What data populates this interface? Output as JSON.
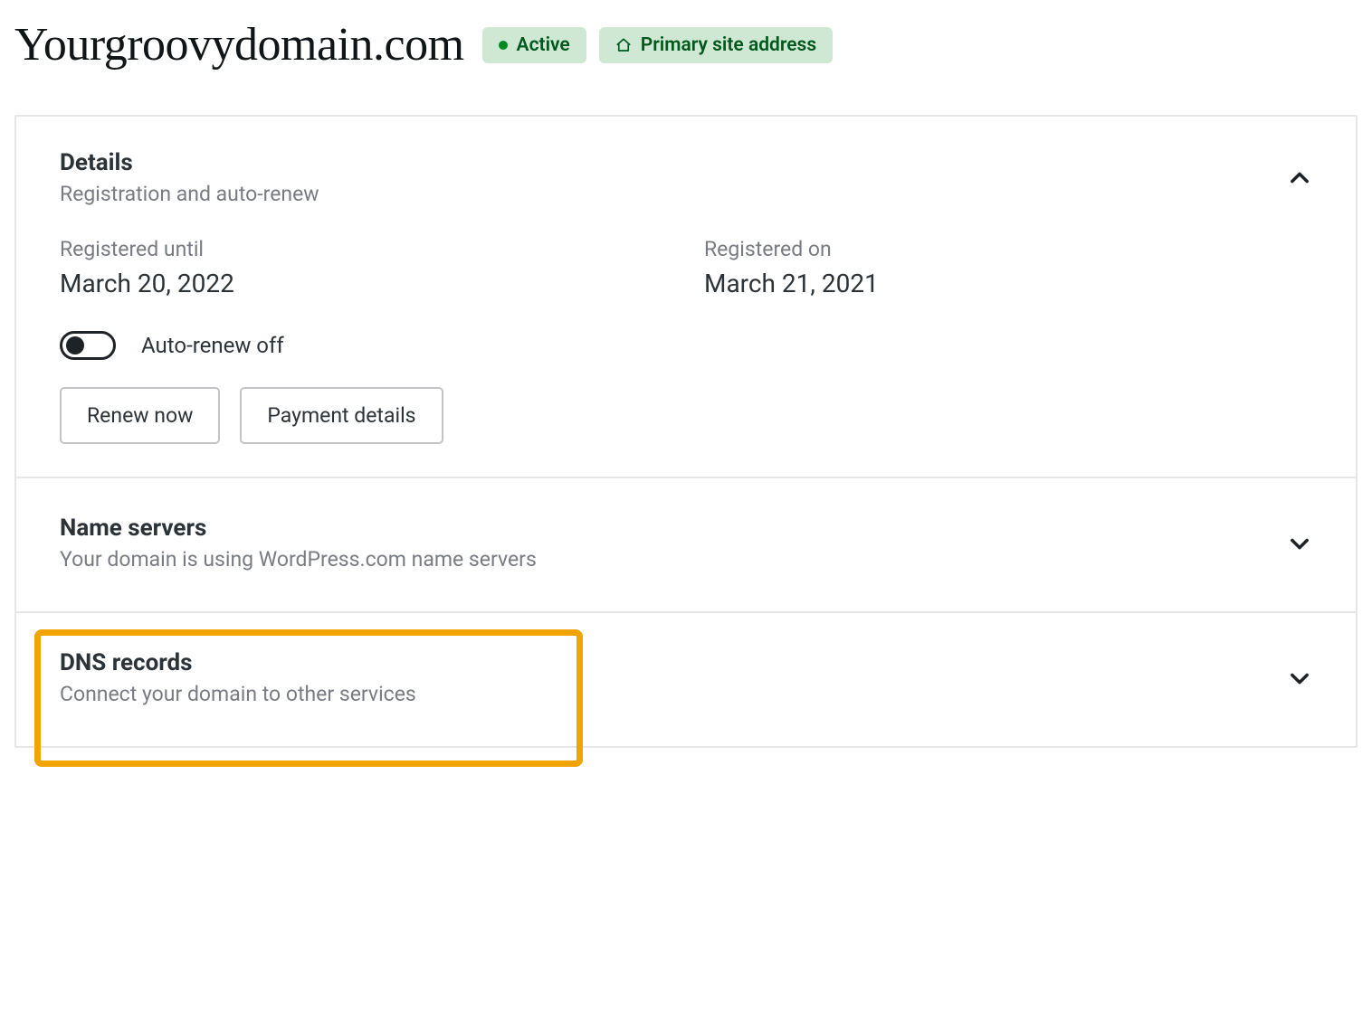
{
  "header": {
    "domain": "Yourgroovydomain.com",
    "badge_active": "Active",
    "badge_primary": "Primary site address"
  },
  "details": {
    "title": "Details",
    "subtitle": "Registration and auto-renew",
    "registered_until_label": "Registered until",
    "registered_until_value": "March 20, 2022",
    "registered_on_label": "Registered on",
    "registered_on_value": "March 21, 2021",
    "auto_renew_label": "Auto-renew off",
    "renew_button": "Renew now",
    "payment_button": "Payment details"
  },
  "nameservers": {
    "title": "Name servers",
    "subtitle": "Your domain is using WordPress.com name servers"
  },
  "dns": {
    "title": "DNS records",
    "subtitle": "Connect your domain to other services"
  }
}
